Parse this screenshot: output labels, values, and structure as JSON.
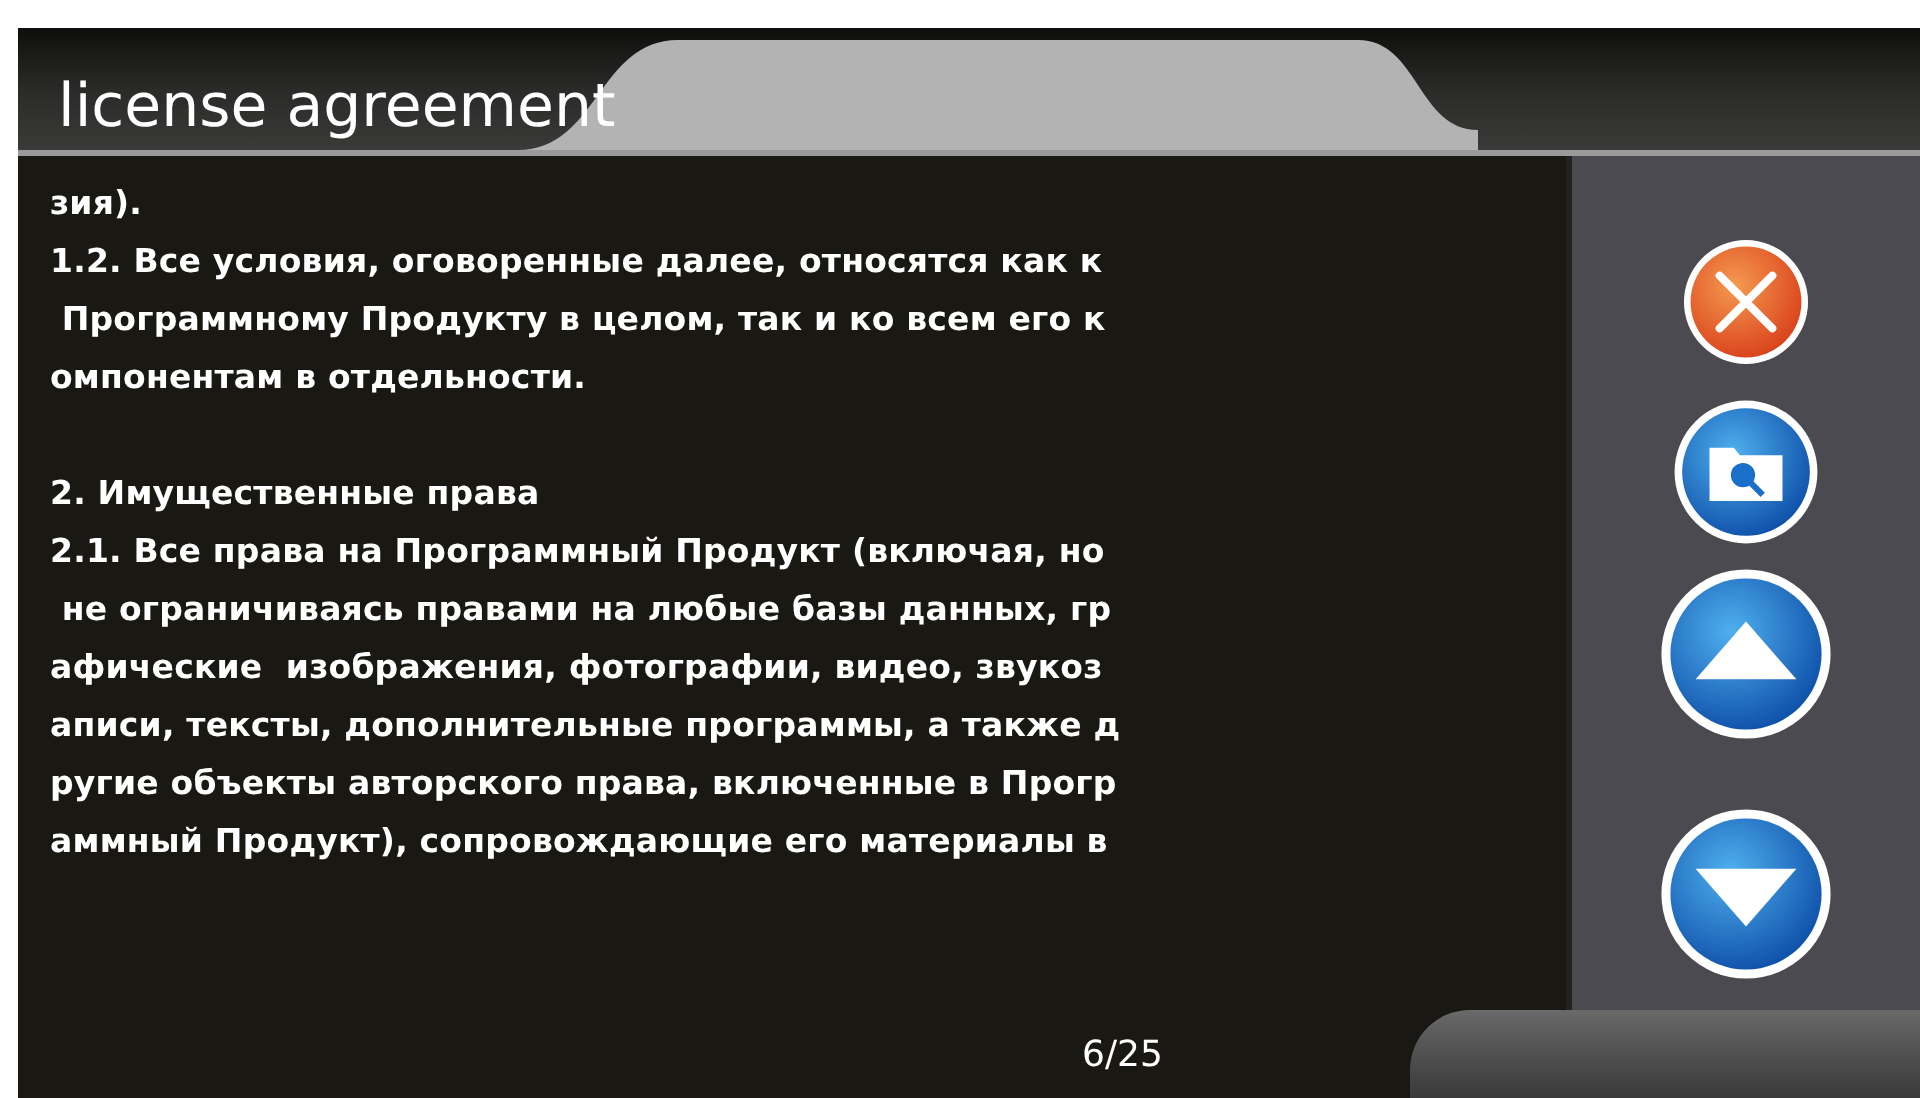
{
  "window": {
    "title": "license agreement"
  },
  "document": {
    "paragraphs": [
      [
        "зия).",
        "1.2. Все условия, оговоренные далее, относятся как к",
        " Программному Продукту в целом, так и ко всем его к",
        "омпонентам в отдельности."
      ],
      [
        "2. Имущественные права",
        "2.1. Все права на Программный Продукт (включая, но",
        " не ограничиваясь правами на любые базы данных, гр",
        "афические  изображения, фотографии, видео, звукоз",
        "аписи, тексты, дополнительные программы, а также д",
        "ругие объекты авторского права, включенные в Прогр",
        "аммный Продукт), сопровождающие его материалы в"
      ]
    ]
  },
  "toolbar": [
    {
      "kind": "close"
    },
    {
      "kind": "search"
    },
    {
      "kind": "up"
    },
    {
      "kind": "down"
    }
  ],
  "page_indicator": "6/25"
}
